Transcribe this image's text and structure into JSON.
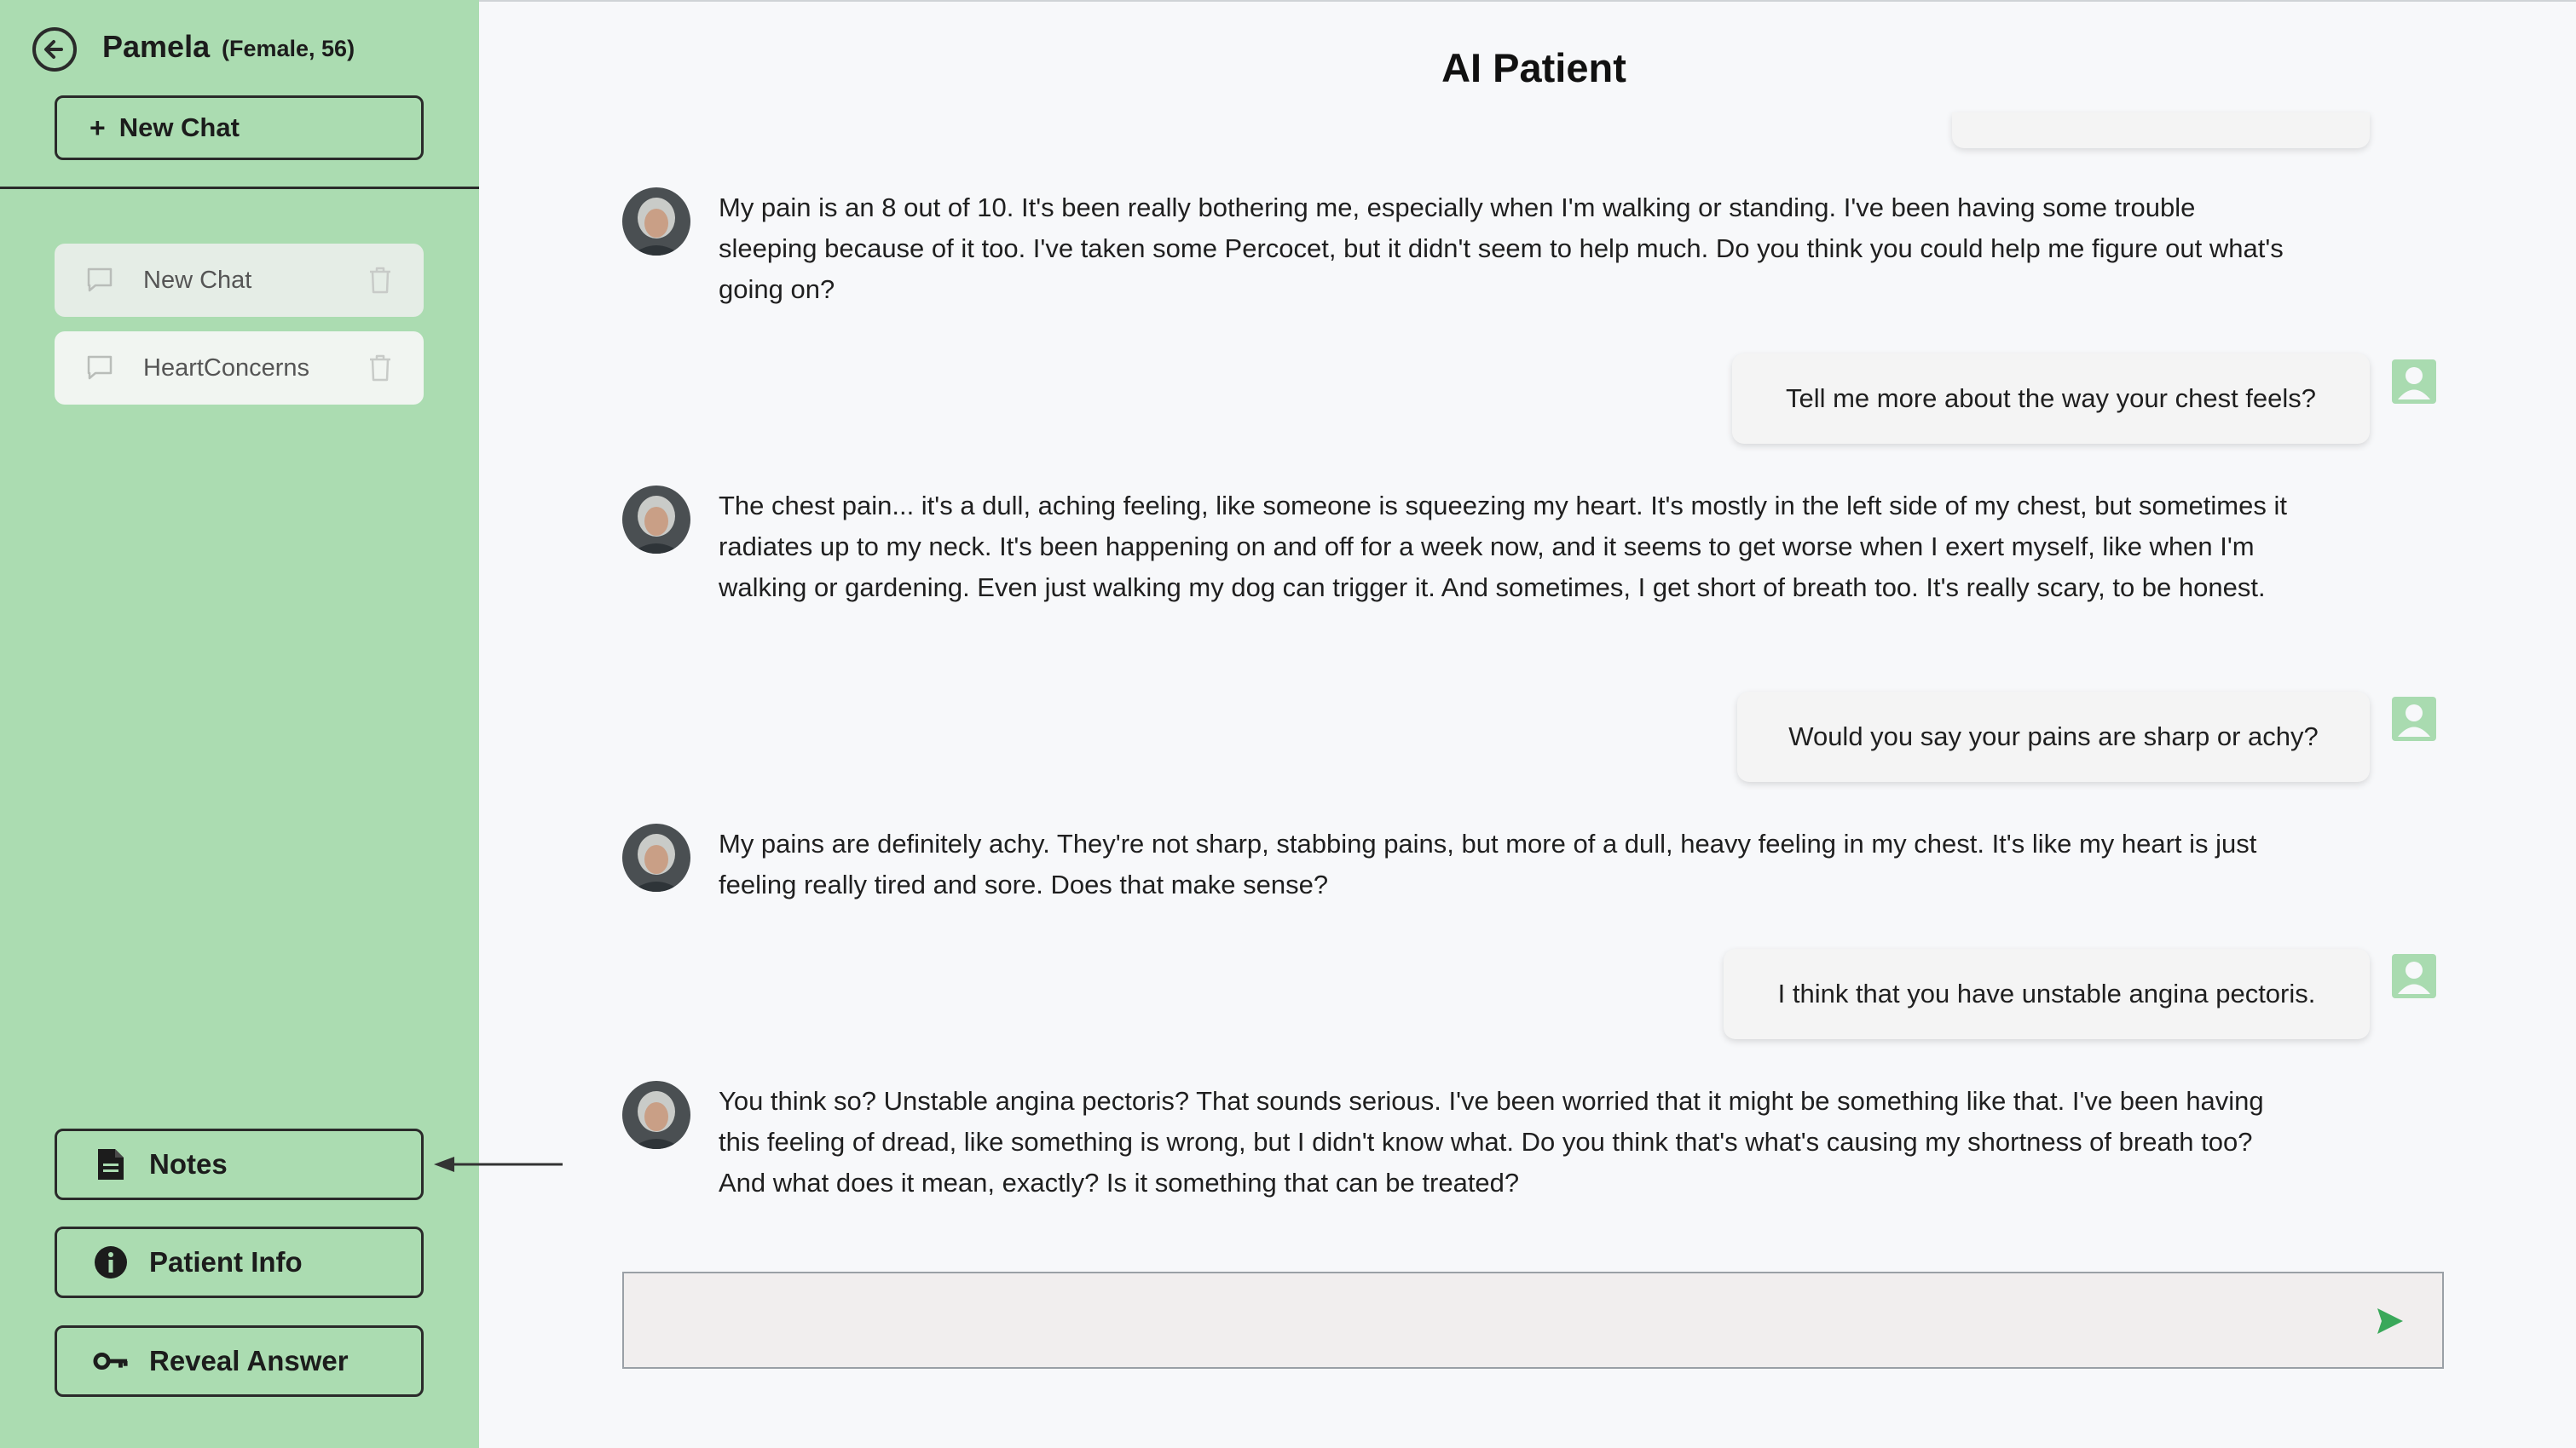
{
  "sidebar": {
    "back_icon": "arrow-left-circle-icon",
    "patient_name": "Pamela",
    "patient_meta": "(Female, 56)",
    "new_chat_label": "New Chat",
    "chats": [
      {
        "label": "New Chat",
        "icon": "chat-bubble-icon"
      },
      {
        "label": "HeartConcerns",
        "icon": "chat-bubble-icon"
      }
    ],
    "buttons": [
      {
        "label": "Notes",
        "icon": "document-icon"
      },
      {
        "label": "Patient Info",
        "icon": "info-icon"
      },
      {
        "label": "Reveal Answer",
        "icon": "key-icon"
      }
    ]
  },
  "main": {
    "title": "AI Patient",
    "messages": [
      {
        "role": "ai",
        "text": "My pain is an 8 out of 10. It's been really bothering me, especially when I'm walking or standing. I've been having some trouble sleeping because of it too. I've taken some Percocet, but it didn't seem to help much. Do you think you could help me figure out what's going on?"
      },
      {
        "role": "user",
        "text": "Tell me more about the way your chest feels?"
      },
      {
        "role": "ai",
        "text": "The chest pain... it's a dull, aching feeling, like someone is squeezing my heart. It's mostly in the left side of my chest, but sometimes it radiates up to my neck. It's been happening on and off for a week now, and it seems to get worse when I exert myself, like when I'm walking or gardening. Even just walking my dog can trigger it. And sometimes, I get short of breath too. It's really scary, to be honest."
      },
      {
        "role": "user",
        "text": "Would you say your pains are sharp or achy?"
      },
      {
        "role": "ai",
        "text": "My pains are definitely achy. They're not sharp, stabbing pains, but more of a dull, heavy feeling in my chest. It's like my heart is just feeling really tired and sore. Does that make sense?"
      },
      {
        "role": "user",
        "text": "I think that you have unstable angina pectoris."
      },
      {
        "role": "ai",
        "text": "You think so? Unstable angina pectoris? That sounds serious. I've been worried that it might be something like that. I've been having this feeling of dread, like something is wrong, but I didn't know what. Do you think that's what's causing my shortness of breath too? And what does it mean, exactly? Is it something that can be treated?"
      }
    ],
    "input_placeholder": "",
    "send_icon": "send-icon"
  },
  "colors": {
    "sidebar_bg": "#abdcb1",
    "accent_green": "#3aa85a",
    "page_bg": "#f7f8fa"
  }
}
